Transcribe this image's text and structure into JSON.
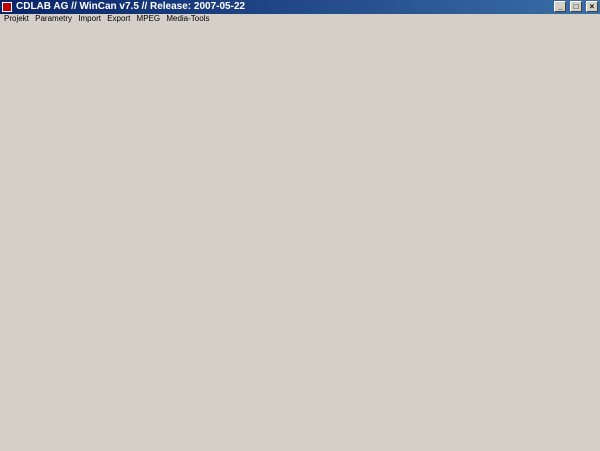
{
  "window": {
    "title": "CDLAB AG // WinCan v7.5 // Release: 2007-05-22",
    "minimize": "_",
    "maximize": "□",
    "close": "×"
  },
  "menu": {
    "items": [
      "Projekt",
      "Parametry",
      "Import",
      "Export",
      "MPEG",
      "Media-Tools"
    ]
  }
}
